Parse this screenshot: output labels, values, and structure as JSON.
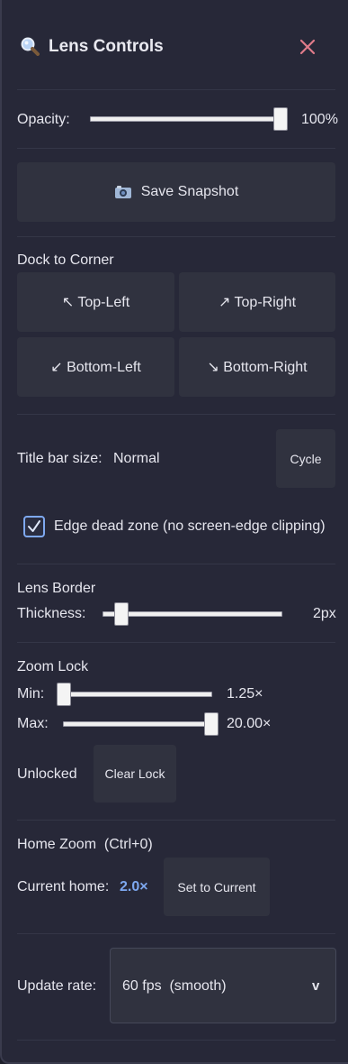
{
  "header": {
    "title": "Lens Controls",
    "icon": "magnifier-icon",
    "close_icon": "close-icon"
  },
  "opacity": {
    "label": "Opacity:",
    "value_text": "100%",
    "level": 1.0
  },
  "snapshot": {
    "icon": "camera-icon",
    "label": "Save Snapshot"
  },
  "dock": {
    "heading": "Dock to Corner",
    "top_left": "↖ Top-Left",
    "top_right": "↗ Top-Right",
    "bottom_left": "↙ Bottom-Left",
    "bottom_right": "↘ Bottom-Right"
  },
  "titlebar": {
    "label": "Title bar size:",
    "value": "Normal",
    "cycle_label": "Cycle"
  },
  "dead_zone": {
    "checked": true,
    "label": "Edge dead zone (no screen-edge clipping)"
  },
  "border": {
    "heading": "Lens Border",
    "thickness_label": "Thickness:",
    "value_text": "2px",
    "level": 0.1
  },
  "zoom_lock": {
    "heading": "Zoom Lock",
    "min_label": "Min:",
    "min_value": "1.25×",
    "min_level": 0.0,
    "max_label": "Max:",
    "max_value": "20.00×",
    "max_level": 1.0,
    "status": "Unlocked",
    "clear_label": "Clear Lock"
  },
  "home_zoom": {
    "heading": "Home Zoom  (Ctrl+0)",
    "current_label": "Current home:",
    "current_value": "2.0×",
    "set_label": "Set to Current",
    "accent": "#7ea8f0"
  },
  "update_rate": {
    "label": "Update rate:",
    "selected": "60 fps  (smooth)",
    "caret": "v"
  },
  "colors": {
    "panel_bg": "#272838",
    "button_bg": "#30323f",
    "close": "#e07b8a",
    "accent": "#7ea8f0"
  }
}
